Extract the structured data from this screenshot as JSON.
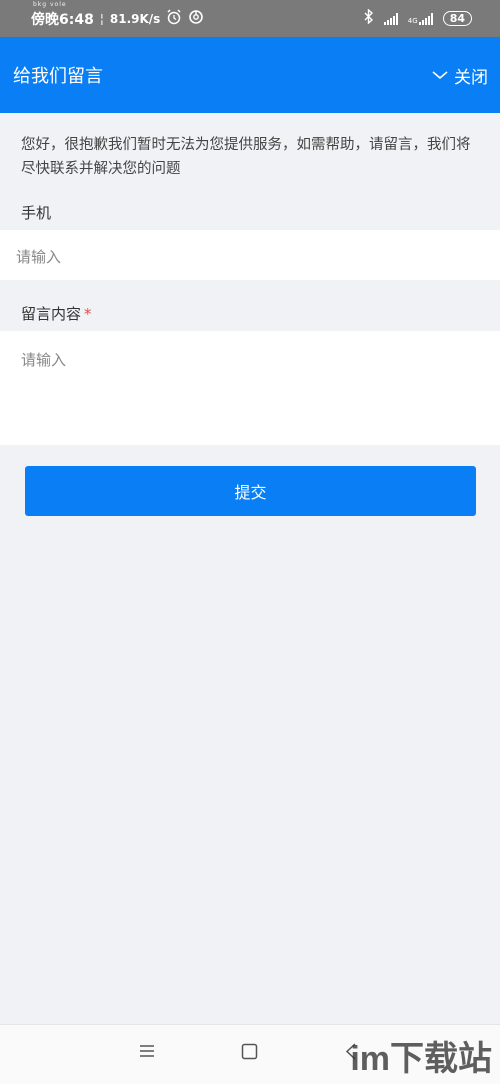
{
  "status_bar": {
    "sub_labels": "bkg vole",
    "time": "傍晚6:48",
    "speed": "81.9K/s",
    "network": "4G",
    "battery": "84",
    "icons": [
      "alarm-icon",
      "sync-icon",
      "bluetooth-icon",
      "signal-icon",
      "battery-icon"
    ]
  },
  "header": {
    "title": "给我们留言",
    "close_label": "关闭",
    "color": "#0a7ff5"
  },
  "notice": "您好，很抱歉我们暂时无法为您提供服务，如需帮助，请留言，我们将尽快联系并解决您的问题",
  "form": {
    "phone_label": "手机",
    "phone_placeholder": "请输入",
    "message_label": "留言内容",
    "required_mark": "*",
    "message_placeholder": "请输入",
    "submit_label": "提交"
  },
  "nav": {
    "icons": [
      "menu-icon",
      "home-square-icon",
      "back-icon"
    ]
  },
  "watermark": "im下载站"
}
